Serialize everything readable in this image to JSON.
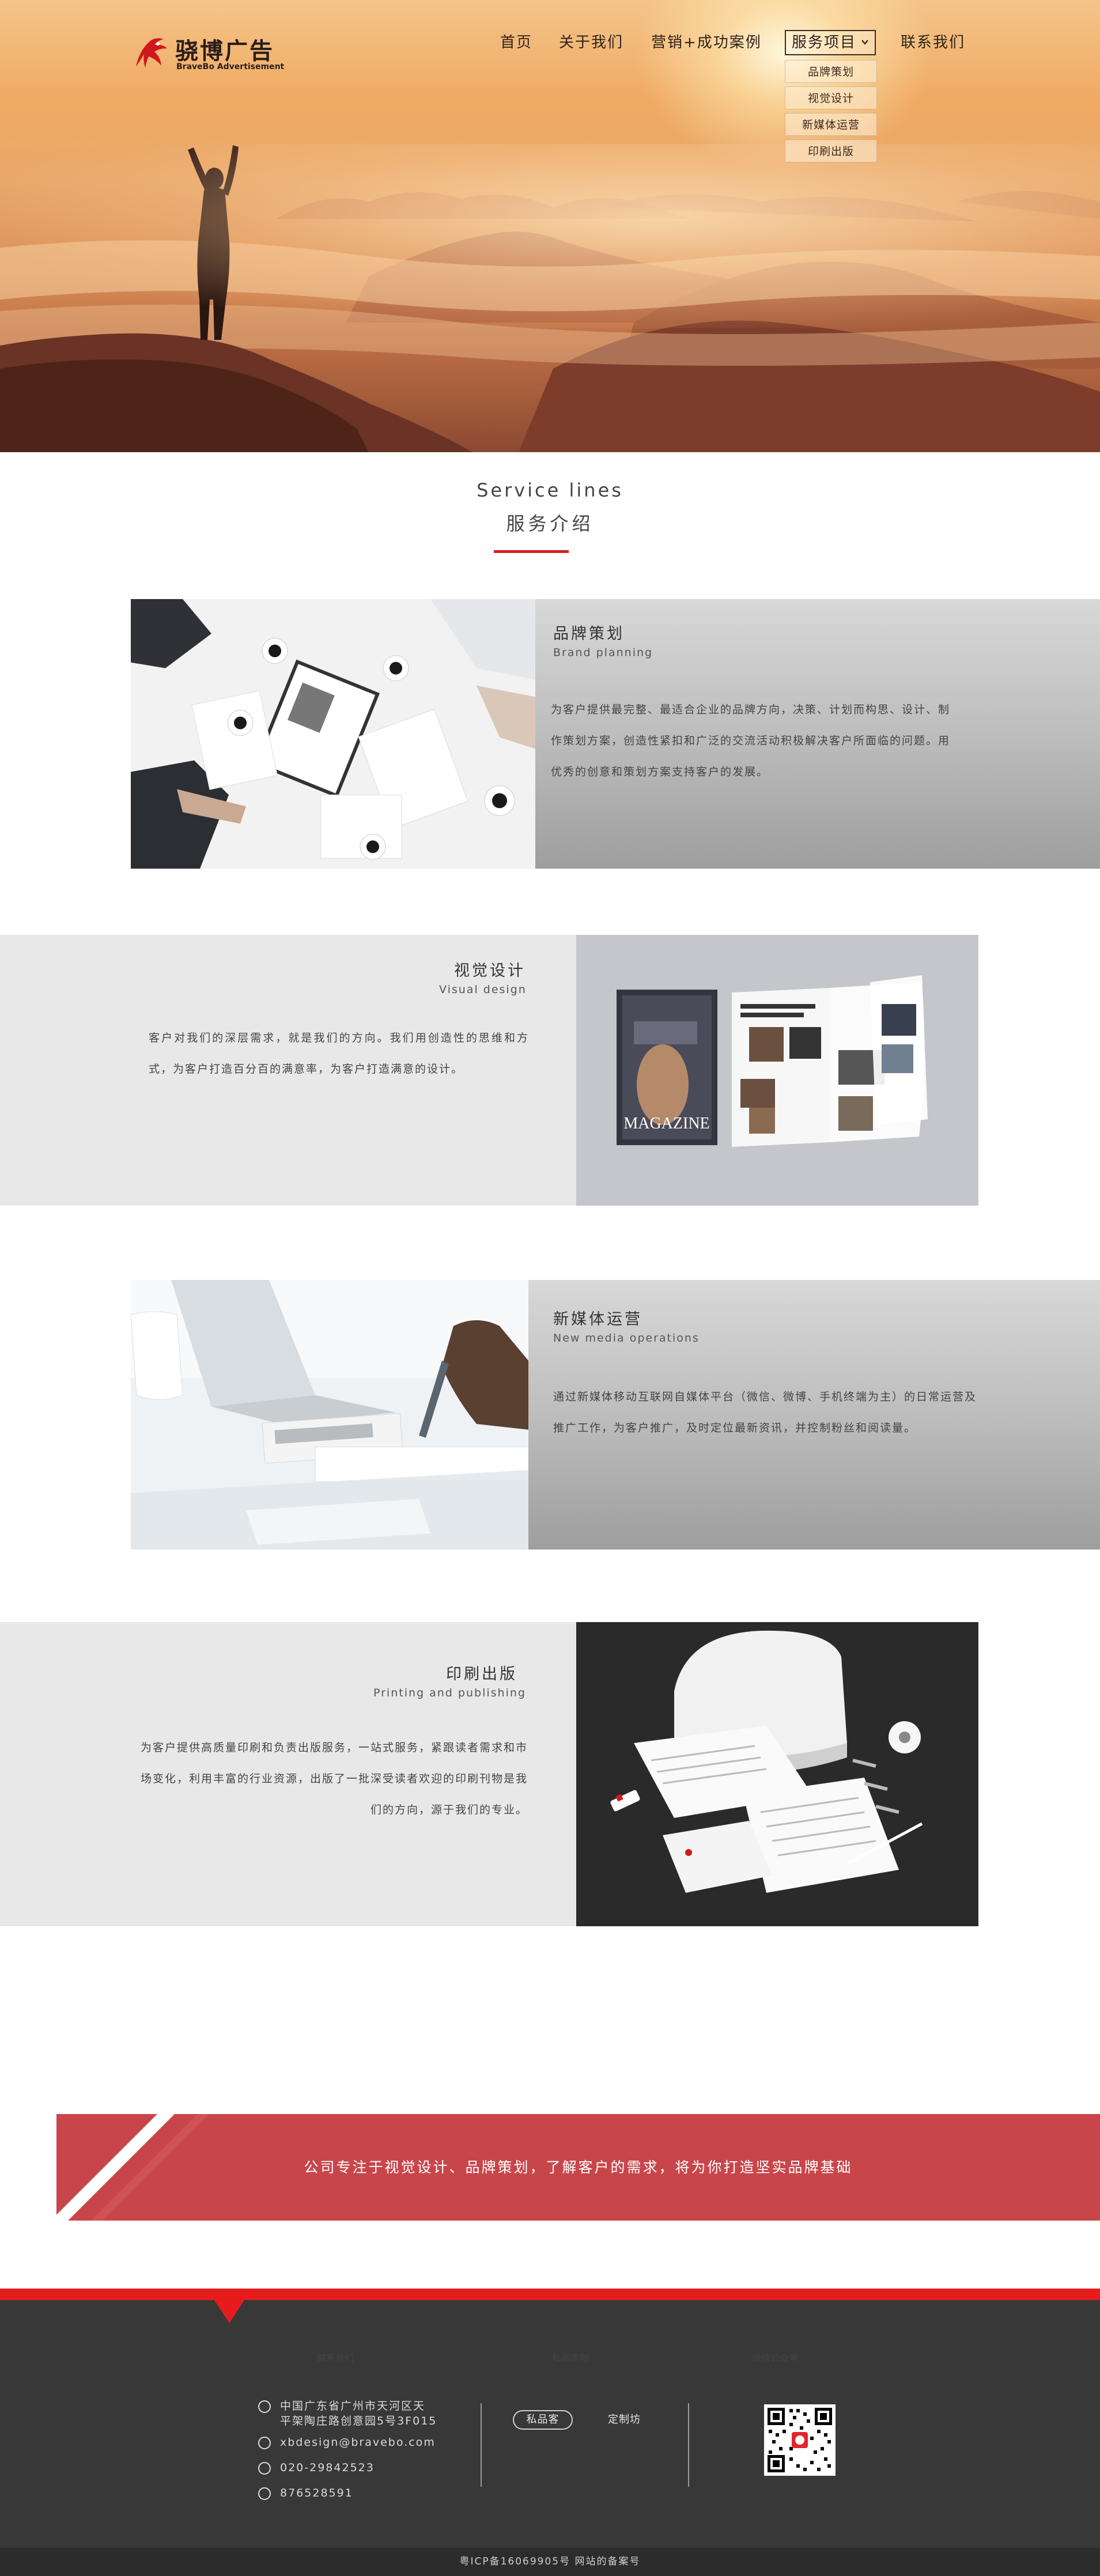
{
  "header": {
    "logo": {
      "cn": "骁博广告",
      "en": "BraveBo Advertisement"
    },
    "nav": [
      {
        "label": "首页"
      },
      {
        "label": "关于我们"
      },
      {
        "label": "营销+成功案例"
      },
      {
        "label": "服务项目",
        "active": true
      },
      {
        "label": "联系我们"
      }
    ],
    "dropdown": [
      {
        "label": "品牌策划"
      },
      {
        "label": "视觉设计"
      },
      {
        "label": "新媒体运营"
      },
      {
        "label": "印刷出版"
      }
    ]
  },
  "section": {
    "title_en": "Service lines",
    "title_cn": "服务介绍",
    "accent_color": "#d31f1f"
  },
  "services": [
    {
      "title": "品牌策划",
      "subtitle": "Brand planning",
      "desc": "为客户提供最完整、最适合企业的品牌方向，决策、计划而构思、设计、制作策划方案，创造性紧扣和广泛的交流活动积极解决客户所面临的问题。用优秀的创意和策划方案支持客户的发展。",
      "image": "meeting-photo"
    },
    {
      "title": "视觉设计",
      "subtitle": "Visual design",
      "desc": "客户对我们的深层需求，就是我们的方向。我们用创造性的思维和方式，为客户打造百分百的满意率，为客户打造满意的设计。",
      "image": "magazine-photo",
      "image_text": "MAGAZINE"
    },
    {
      "title": "新媒体运营",
      "subtitle": "New media operations",
      "desc": "通过新媒体移动互联网自媒体平台（微信、微博、手机终端为主）的日常运营及推广工作，为客户推广，及时定位最新资讯，并控制粉丝和阅读量。",
      "image": "laptop-writing-photo"
    },
    {
      "title": "印刷出版",
      "subtitle": "Printing and publishing",
      "desc": "为客户提供高质量印刷和负责出版服务，一站式服务，紧跟读者需求和市场变化，利用丰富的行业资源，出版了一批深受读者欢迎的印刷刊物是我们的方向，源于我们的专业。",
      "image": "printer-stationery-photo"
    }
  ],
  "banner": {
    "text": "公司专注于视觉设计、品牌策划，了解客户的需求，将为你打造坚实品牌基础",
    "color": "#c8464a"
  },
  "footer": {
    "contact_heading": "联系我们",
    "custom_heading": "私品定制",
    "wechat_heading": "微信公众号",
    "contacts": [
      {
        "icon": "location-icon",
        "text": "中国广东省广州市天河区天",
        "text2": "平架陶庄路创意园5号3F015"
      },
      {
        "icon": "email-icon",
        "text": "xbdesign@bravebo.com"
      },
      {
        "icon": "phone-icon",
        "text": "020-29842523"
      },
      {
        "icon": "qq-icon",
        "text": "876528591"
      }
    ],
    "custom_pill": "私品客",
    "custom_link": "定制坊",
    "copyright": "粤ICP备16069905号 网站的备案号",
    "red": "#e61c1c",
    "bg": "#383838"
  }
}
